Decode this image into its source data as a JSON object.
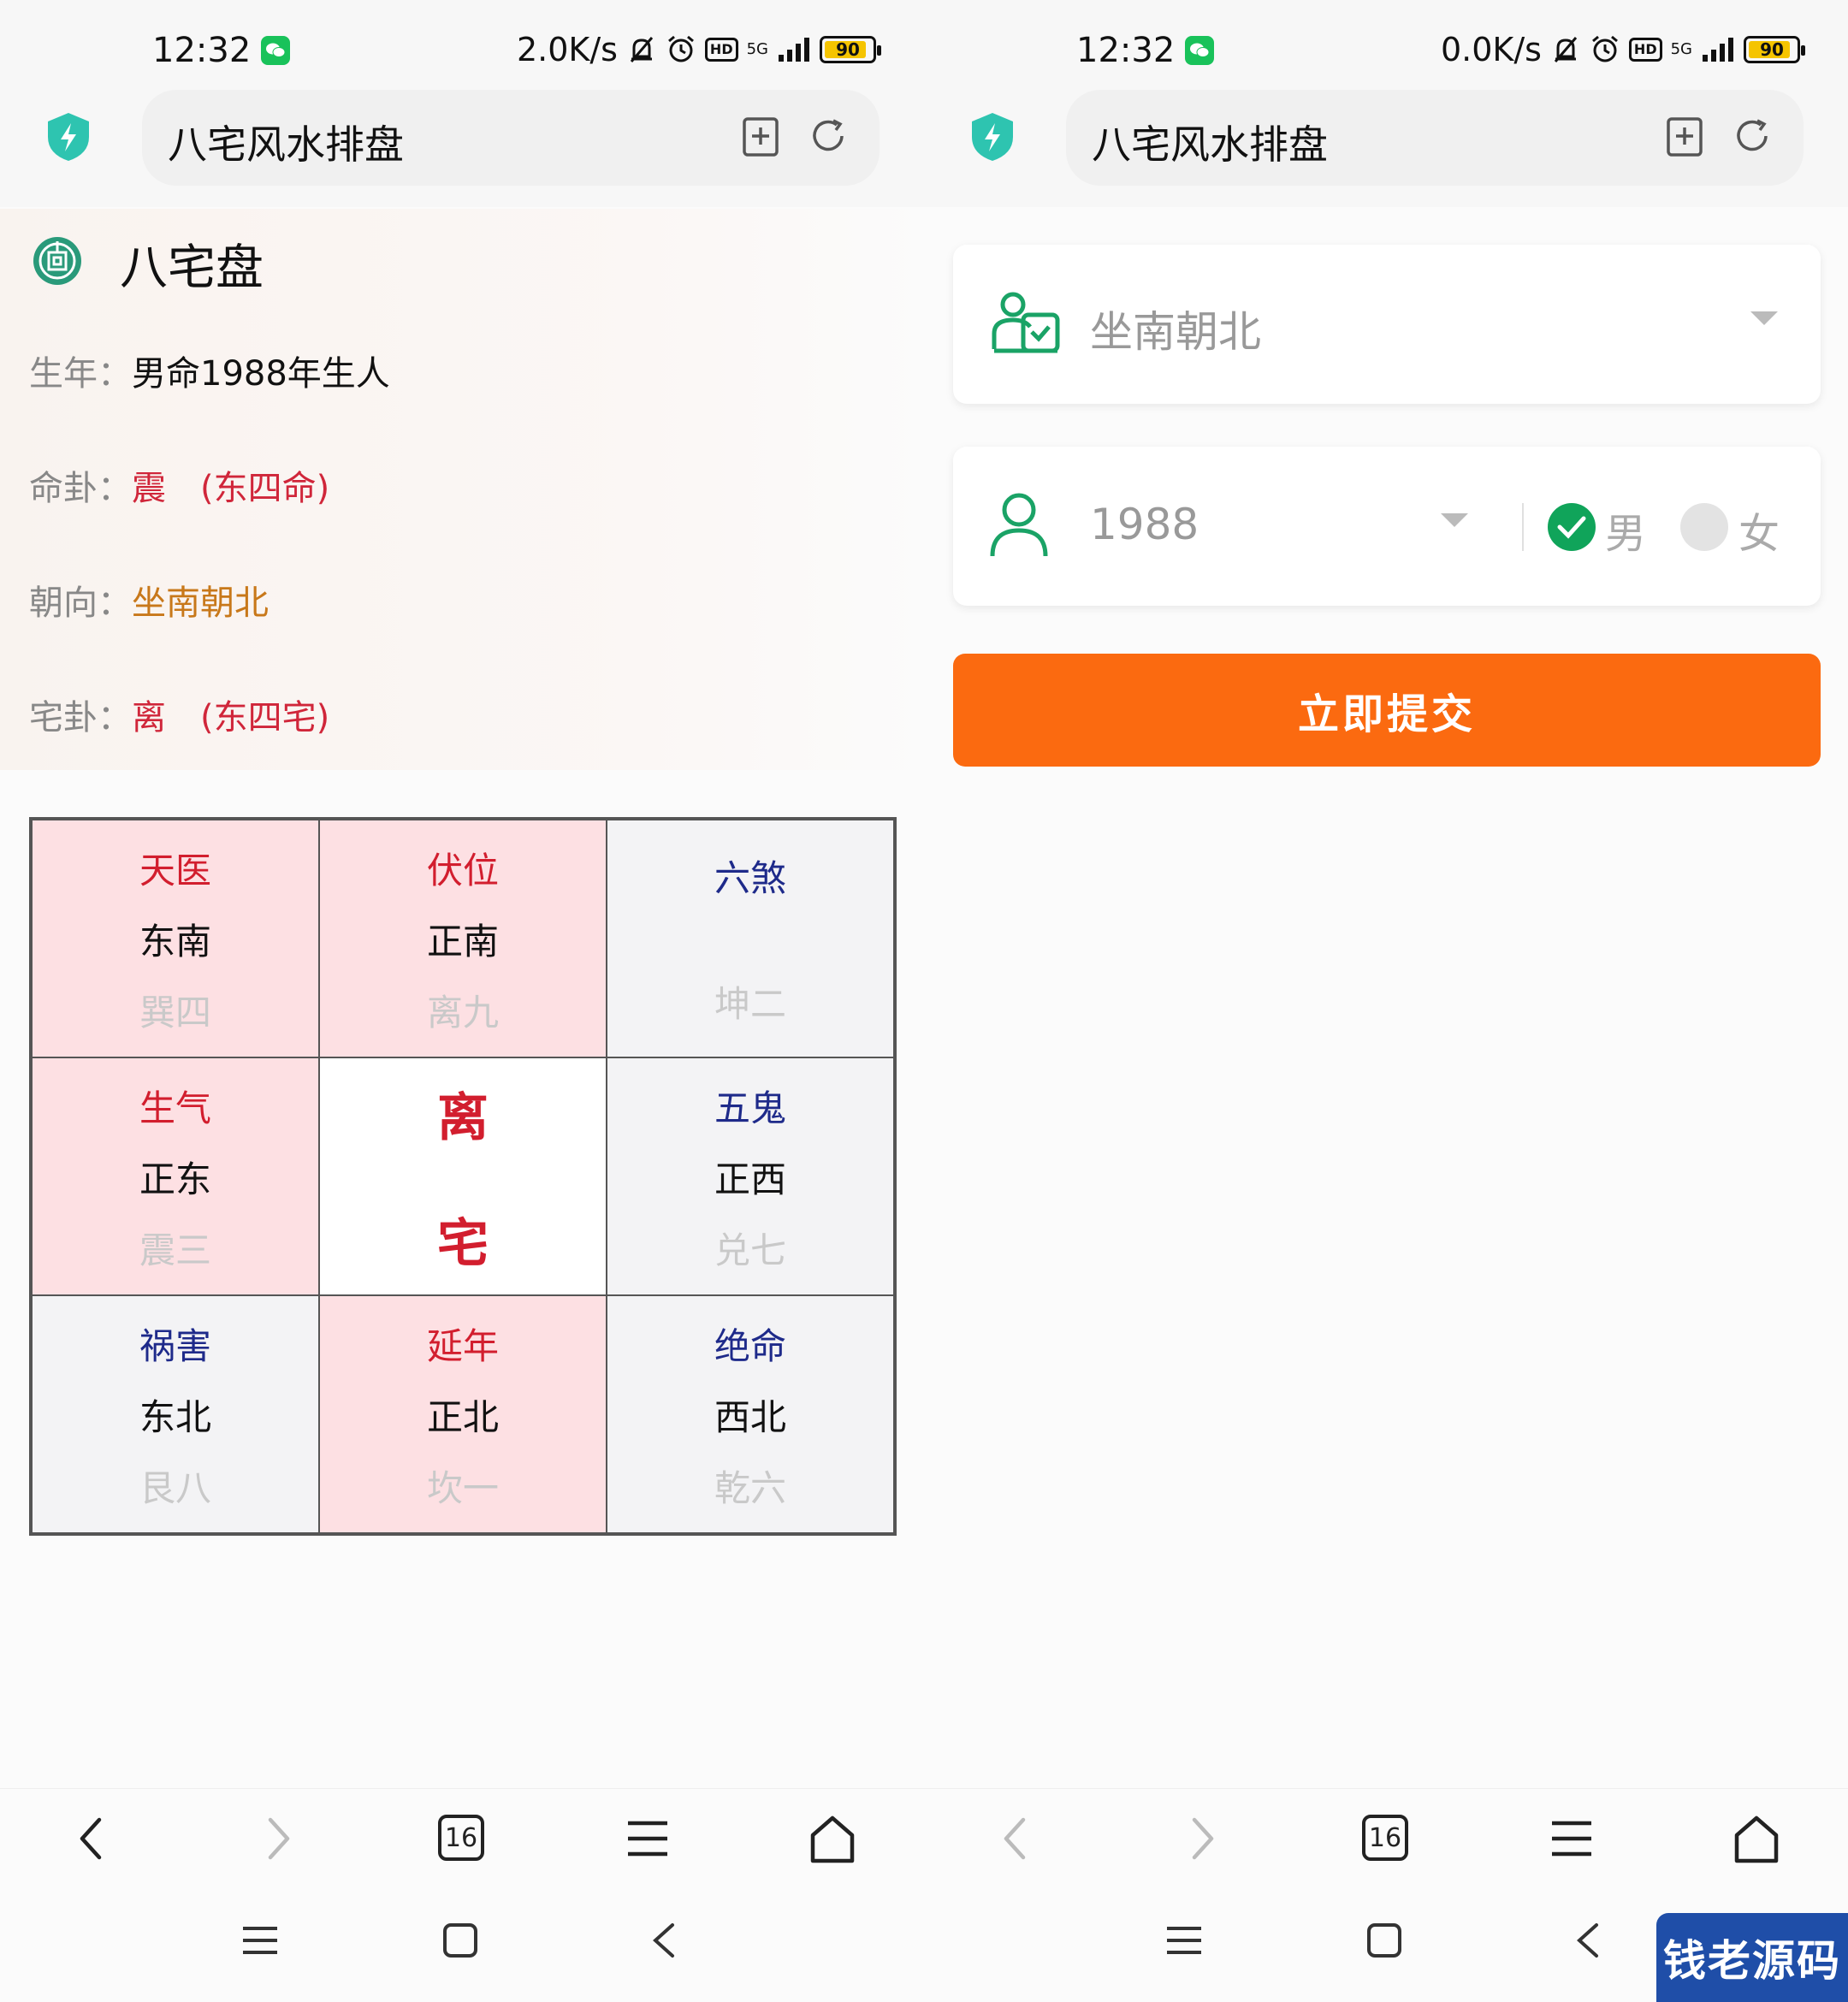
{
  "left_phone": {
    "status": {
      "time": "12:32",
      "speed": "2.0K/s",
      "hd": "HD",
      "net": "5G",
      "battery": "90"
    },
    "address_bar": {
      "title": "八宅风水排盘"
    },
    "info": {
      "heading": "八宅盘",
      "rows": [
        {
          "label": "生年：",
          "value": "男命1988年生人"
        },
        {
          "label": "命卦：",
          "value": "震　(东四命)"
        },
        {
          "label": "朝向：",
          "value": "坐南朝北"
        },
        {
          "label": "宅卦：",
          "value": "离　(东四宅)"
        }
      ]
    },
    "grid": {
      "cells": [
        {
          "star": "天医",
          "direction": "东南",
          "gua": "巽四",
          "auspicious": true
        },
        {
          "star": "伏位",
          "direction": "正南",
          "gua": "离九",
          "auspicious": true
        },
        {
          "star": "六煞",
          "direction": "",
          "gua": "坤二",
          "auspicious": false
        },
        {
          "star": "生气",
          "direction": "正东",
          "gua": "震三",
          "auspicious": true
        },
        {
          "center_top": "离",
          "center_bottom": "宅"
        },
        {
          "star": "五鬼",
          "direction": "正西",
          "gua": "兑七",
          "auspicious": false
        },
        {
          "star": "祸害",
          "direction": "东北",
          "gua": "艮八",
          "auspicious": false
        },
        {
          "star": "延年",
          "direction": "正北",
          "gua": "坎一",
          "auspicious": true
        },
        {
          "star": "绝命",
          "direction": "西北",
          "gua": "乾六",
          "auspicious": false
        }
      ]
    },
    "toolbar": {
      "tabs_count": "16"
    }
  },
  "right_phone": {
    "status": {
      "time": "12:32",
      "speed": "0.0K/s",
      "hd": "HD",
      "net": "5G",
      "battery": "90"
    },
    "address_bar": {
      "title": "八宅风水排盘"
    },
    "form": {
      "orientation_value": "坐南朝北",
      "year_value": "1988",
      "gender_male": "男",
      "gender_female": "女",
      "selected_gender": "男",
      "submit_label": "立即提交"
    },
    "toolbar": {
      "tabs_count": "16"
    }
  },
  "watermark": {
    "text": "钱老源码"
  },
  "colors": {
    "accent_orange": "#fb6a10",
    "accent_green": "#10a45a",
    "auspicious_red": "#d21e2e",
    "inauspicious_blue": "#1e2a8a",
    "cell_pink": "#fde0e3"
  }
}
